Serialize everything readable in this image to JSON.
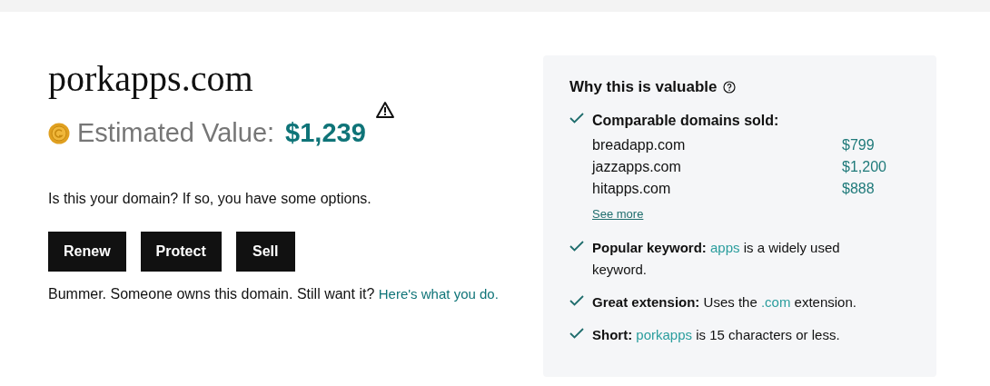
{
  "domain": "porkapps.com",
  "estimate": {
    "label": "Estimated Value:",
    "value": "$1,239"
  },
  "prompt": "Is this your domain? If so, you have some options.",
  "buttons": [
    "Renew",
    "Protect",
    "Sell"
  ],
  "owned_note": {
    "text": "Bummer. Someone owns this domain. Still want it?",
    "link": "Here's what you do."
  },
  "panel": {
    "title": "Why this is valuable",
    "comparables": {
      "label": "Comparable domains sold:",
      "rows": [
        {
          "domain": "breadapp.com",
          "price": "$799"
        },
        {
          "domain": "jazzapps.com",
          "price": "$1,200"
        },
        {
          "domain": "hitapps.com",
          "price": "$888"
        }
      ],
      "more": "See more"
    },
    "reasons": [
      {
        "before": "**Popular keyword:** ",
        "keyword": "apps",
        "after": " is a widely used keyword."
      },
      {
        "before": "**Great extension:** Uses the ",
        "keyword": ".com",
        "after": " extension."
      },
      {
        "before": "**Short:** ",
        "keyword": "porkapps",
        "after": " is 15 characters or less."
      }
    ]
  }
}
